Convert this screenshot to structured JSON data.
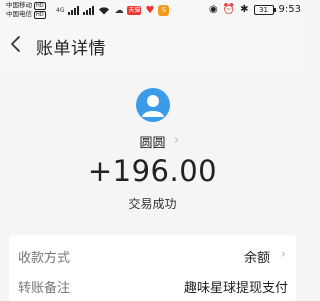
{
  "status_bar": {
    "carrier_1": "中国移动",
    "carrier_2": "中国电信",
    "hd_1": "HD",
    "hd_2": "HD",
    "network_4g": "4G",
    "badge_text": "天猫",
    "orange_badge": "S",
    "battery": "31",
    "time": "9:53"
  },
  "nav": {
    "title": "账单详情"
  },
  "payee": {
    "name": "圆圆",
    "chevron": "›"
  },
  "transaction": {
    "amount": "+196.00",
    "status": "交易成功"
  },
  "details": [
    {
      "label": "收款方式",
      "value": "余额",
      "arrow": "›"
    },
    {
      "label": "转账备注",
      "value": "趣味星球提现支付"
    }
  ],
  "colors": {
    "avatar": "#3c9be8",
    "background": "#f5f5f5",
    "card": "#ffffff"
  },
  "icons": {
    "back": "back-arrow-icon",
    "avatar": "user-avatar-icon"
  }
}
